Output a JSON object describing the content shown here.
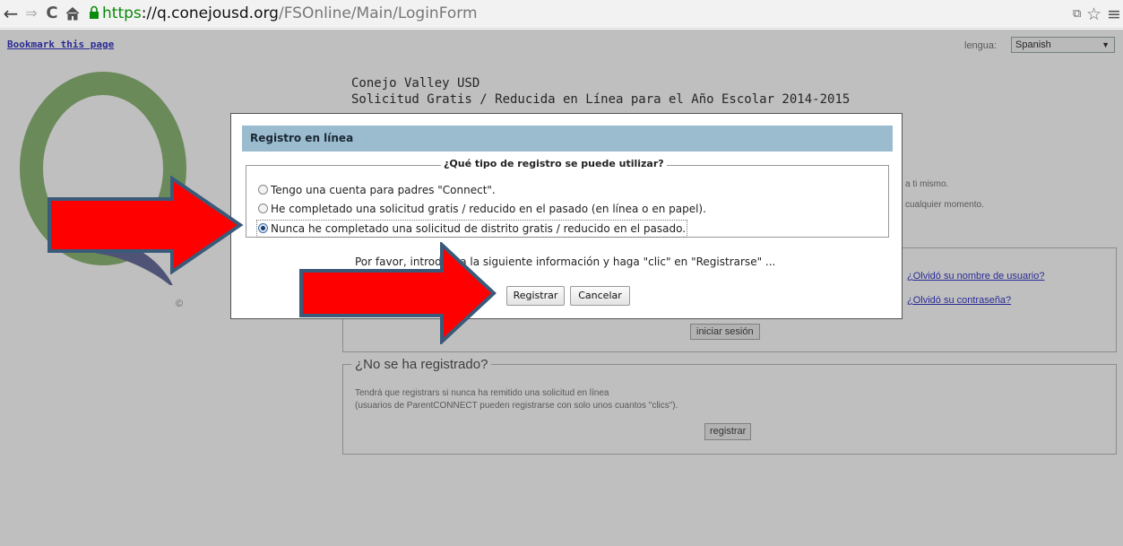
{
  "browser": {
    "url_scheme": "https",
    "url_separator": "://",
    "url_host": "q.conejousd.org",
    "url_path": "/FSOnline/Main/LoginForm",
    "icons": [
      "back-arrow-icon",
      "forward-arrow-icon",
      "reload-icon",
      "home-icon",
      "lock-icon",
      "translate-icon",
      "star-icon",
      "menu-icon"
    ]
  },
  "page": {
    "bookmark_link": "Bookmark this page",
    "lang_label": "lengua:",
    "lang_selected": "Spanish",
    "org_name": "Conejo Valley USD",
    "app_title": "Solicitud Gratis / Reducida en Línea para el Año Escolar 2014-2015",
    "copyright": "©",
    "side_text_1": "a ti mismo.",
    "side_text_2": "cualquier momento.",
    "forgot_username": "¿Olvidó su nombre de usuario?",
    "forgot_password": "¿Olvidó su contraseña?",
    "login_button": "iniciar sesión",
    "not_registered_title": "¿No se ha registrado?",
    "not_registered_text_1": "Tendrá que registrars si nunca ha remitido una solicitud en línea",
    "not_registered_text_2": "(usuarios de ParentCONNECT pueden registrarse con solo unos cuantos \"clics\").",
    "register_button": "registrar"
  },
  "dialog": {
    "title": "Registro en línea",
    "question": "¿Qué tipo de registro se puede utilizar?",
    "options": [
      {
        "label": "Tengo una cuenta para padres \"Connect\".",
        "selected": false
      },
      {
        "label": "He completado una solicitud gratis / reducido en el pasado (en línea o en papel).",
        "selected": false
      },
      {
        "label": "Nunca he completado una solicitud de distrito gratis / reducido en el pasado.",
        "selected": true
      }
    ],
    "instruction": "Por favor, introduzca la siguiente información y haga \"clic\" en \"Registrarse\" ...",
    "register_label": "Registrar",
    "cancel_label": "Cancelar"
  },
  "colors": {
    "dialog_header": "#9bbccf",
    "arrow_fill": "#ff0000",
    "arrow_stroke": "#3a5a7a",
    "logo_green": "#8fb878",
    "logo_purple": "#6a6f9c",
    "link_blue": "#3a3ac8"
  }
}
